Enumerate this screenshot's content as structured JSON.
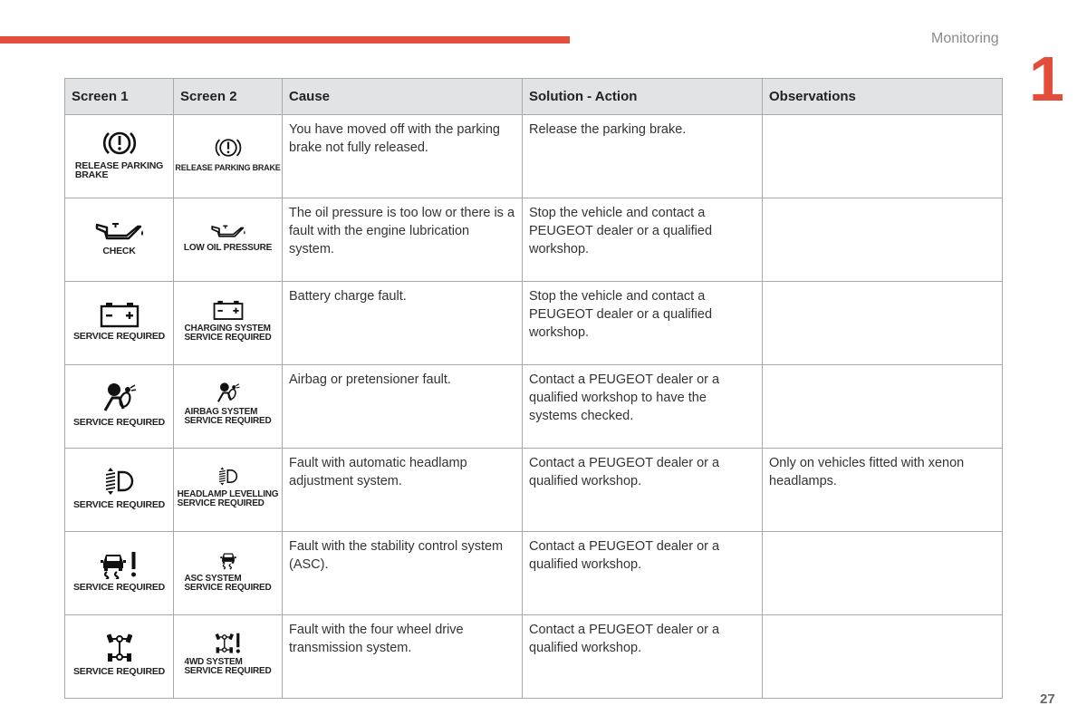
{
  "header": {
    "section_title": "Monitoring",
    "chapter_number": "1",
    "accent_color": "#e24e3b"
  },
  "footer": {
    "page_number": "27"
  },
  "table": {
    "headers": [
      "Screen 1",
      "Screen 2",
      "Cause",
      "Solution - Action",
      "Observations"
    ],
    "rows": [
      {
        "screen1": {
          "icon": "parking-brake-warning-icon",
          "label": "RELEASE PARKING\nBRAKE"
        },
        "screen2": {
          "icon": "parking-brake-warning-icon",
          "label": "RELEASE PARKING BRAKE"
        },
        "cause": "You have moved off with the parking brake not fully released.",
        "solution": "Release the parking brake.",
        "observations": ""
      },
      {
        "screen1": {
          "icon": "oil-can-icon",
          "label": "CHECK"
        },
        "screen2": {
          "icon": "oil-can-icon",
          "label": "LOW OIL PRESSURE"
        },
        "cause": "The oil pressure is too low or there is a fault with the engine lubrication system.",
        "solution": "Stop the vehicle and contact a PEUGEOT dealer or a qualified workshop.",
        "observations": ""
      },
      {
        "screen1": {
          "icon": "battery-icon",
          "label": "SERVICE REQUIRED"
        },
        "screen2": {
          "icon": "battery-icon",
          "label": "CHARGING SYSTEM\nSERVICE REQUIRED"
        },
        "cause": "Battery charge fault.",
        "solution": "Stop the vehicle and contact a PEUGEOT dealer or a qualified workshop.",
        "observations": ""
      },
      {
        "screen1": {
          "icon": "airbag-icon",
          "label": "SERVICE REQUIRED"
        },
        "screen2": {
          "icon": "airbag-icon",
          "label": "AIRBAG SYSTEM\nSERVICE REQUIRED"
        },
        "cause": "Airbag or pretensioner fault.",
        "solution": "Contact a PEUGEOT dealer or a qualified workshop to have the systems checked.",
        "observations": ""
      },
      {
        "screen1": {
          "icon": "headlamp-levelling-icon",
          "label": "SERVICE REQUIRED"
        },
        "screen2": {
          "icon": "headlamp-levelling-icon",
          "label": "HEADLAMP LEVELLING\nSERVICE REQUIRED"
        },
        "cause": "Fault with automatic headlamp adjustment system.",
        "solution": "Contact a PEUGEOT dealer or a qualified workshop.",
        "observations": "Only on vehicles fitted with xenon headlamps."
      },
      {
        "screen1": {
          "icon": "stability-control-icon",
          "label": "SERVICE REQUIRED"
        },
        "screen2": {
          "icon": "stability-control-icon",
          "label": "ASC SYSTEM\nSERVICE REQUIRED"
        },
        "cause": "Fault with the stability control system (ASC).",
        "solution": "Contact a PEUGEOT dealer or a qualified workshop.",
        "observations": ""
      },
      {
        "screen1": {
          "icon": "four-wheel-drive-icon",
          "label": "SERVICE REQUIRED"
        },
        "screen2": {
          "icon": "four-wheel-drive-icon",
          "label": "4WD SYSTEM\nSERVICE REQUIRED"
        },
        "cause": "Fault with the four wheel drive transmission system.",
        "solution": "Contact a PEUGEOT dealer or a qualified workshop.",
        "observations": ""
      }
    ]
  }
}
